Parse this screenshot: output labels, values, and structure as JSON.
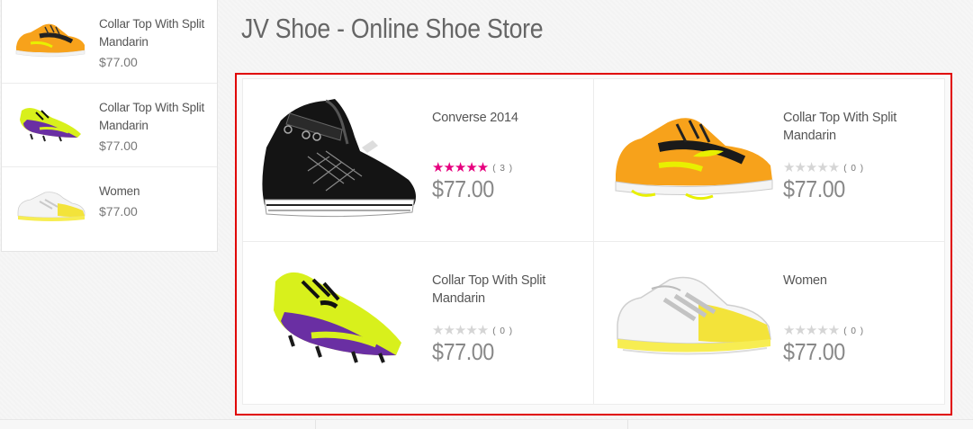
{
  "header": {
    "title": "JV Shoe - Online Shoe Store"
  },
  "sidebar": {
    "items": [
      {
        "name": "Collar Top With Split Mandarin",
        "price": "$77.00",
        "icon": "orange-running-shoe-icon"
      },
      {
        "name": "Collar Top With Split Mandarin",
        "price": "$77.00",
        "icon": "yellow-purple-soccer-cleat-icon"
      },
      {
        "name": "Women",
        "price": "$77.00",
        "icon": "white-yellow-tennis-shoe-icon"
      }
    ]
  },
  "products": [
    {
      "name": "Converse 2014",
      "price": "$77.00",
      "rating": 5,
      "reviews": "( 3 )",
      "icon": "black-high-top-sneaker-icon"
    },
    {
      "name": "Collar Top With Split Mandarin",
      "price": "$77.00",
      "rating": 0,
      "reviews": "( 0 )",
      "icon": "orange-running-shoe-icon"
    },
    {
      "name": "Collar Top With Split Mandarin",
      "price": "$77.00",
      "rating": 0,
      "reviews": "( 0 )",
      "icon": "yellow-purple-soccer-cleat-icon"
    },
    {
      "name": "Women",
      "price": "$77.00",
      "rating": 0,
      "reviews": "( 0 )",
      "icon": "white-yellow-tennis-shoe-icon"
    }
  ],
  "colors": {
    "highlight_border": "#e00000",
    "star_active": "#e6007e",
    "star_inactive": "#d5d5d5"
  }
}
